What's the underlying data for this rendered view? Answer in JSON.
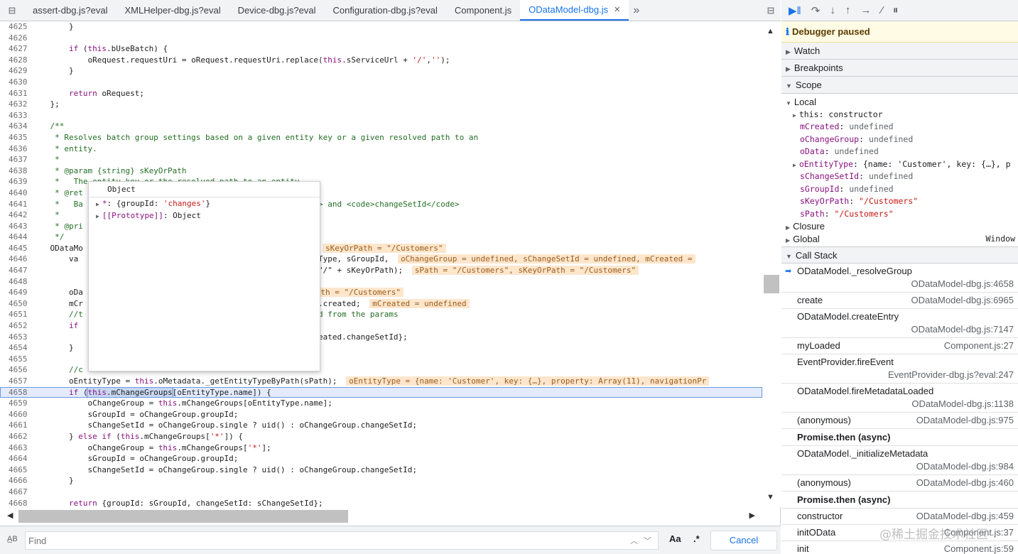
{
  "tabs": [
    {
      "label": "assert-dbg.js?eval"
    },
    {
      "label": "XMLHelper-dbg.js?eval"
    },
    {
      "label": "Device-dbg.js?eval"
    },
    {
      "label": "Configuration-dbg.js?eval"
    },
    {
      "label": "Component.js"
    },
    {
      "label": "ODataModel-dbg.js",
      "active": true
    }
  ],
  "code_lines": [
    {
      "n": "4625",
      "h": "        }"
    },
    {
      "n": "4626",
      "h": ""
    },
    {
      "n": "4627",
      "h": "        <span class=\"kw\">if</span> (<span class=\"kw\">this</span>.bUseBatch) {"
    },
    {
      "n": "4628",
      "h": "            oRequest.requestUri = oRequest.requestUri.replace(<span class=\"kw\">this</span>.sServiceUrl + <span class=\"str\">'/'</span>,<span class=\"str\">''</span>);"
    },
    {
      "n": "4629",
      "h": "        }"
    },
    {
      "n": "4630",
      "h": ""
    },
    {
      "n": "4631",
      "h": "        <span class=\"kw\">return</span> oRequest;"
    },
    {
      "n": "4632",
      "h": "    };"
    },
    {
      "n": "4633",
      "h": ""
    },
    {
      "n": "4634",
      "h": "    <span class=\"cm\">/**</span>"
    },
    {
      "n": "4635",
      "h": "<span class=\"cm\">     * Resolves batch group settings based on a given entity key or a given resolved path to an</span>"
    },
    {
      "n": "4636",
      "h": "<span class=\"cm\">     * entity.</span>"
    },
    {
      "n": "4637",
      "h": "<span class=\"cm\">     *</span>"
    },
    {
      "n": "4638",
      "h": "<span class=\"cm\">     * @param {string} sKeyOrPath</span>"
    },
    {
      "n": "4639",
      "h": "<span class=\"cm\">     *   The entity key or the resolved path to an entity</span>"
    },
    {
      "n": "4640",
      "h": "<span class=\"cm\">     * @ret</span>"
    },
    {
      "n": "4641",
      "h": "<span class=\"cm\">     *   Ba                                                  &gt; and &lt;code&gt;changeSetId&lt;/code&gt;</span>"
    },
    {
      "n": "4642",
      "h": "<span class=\"cm\">     *</span>"
    },
    {
      "n": "4643",
      "h": "<span class=\"cm\">     * @pri</span>"
    },
    {
      "n": "4644",
      "h": "<span class=\"cm\">     */</span>"
    },
    {
      "n": "4645",
      "h": "    ODataMo                                           Path) {<span class=\"iv\">sKeyOrPath = \"/Customers\"</span>"
    },
    {
      "n": "4646",
      "h": "        va                                            oEntityType, sGroupId, <span class=\"iv\">oChangeGroup = undefined, sChangeSetId = undefined, mCreated =</span>"
    },
    {
      "n": "4647",
      "h": "                                                      ath : (\"/\" + sKeyOrPath); <span class=\"iv\">sPath = \"/Customers\", sKeyOrPath = \"/Customers\"</span>"
    },
    {
      "n": "4648",
      "h": ""
    },
    {
      "n": "4649",
      "h": "        oDa                                         <span class=\"iv\">ned, sPath = \"/Customers\"</span>"
    },
    {
      "n": "4650",
      "h": "        mCr                                           etadata.created; <span class=\"iv\">mCreated = undefined</span>"
    },
    {
      "n": "4651",
      "h": "        <span class=\"cm\">//t                                           etrieved from the params</span>"
    },
    {
      "n": "4652",
      "h": "        <span class=\"kw\">if</span>"
    },
    {
      "n": "4653",
      "h": "                                                      Id: mCreated.changeSetId};"
    },
    {
      "n": "4654",
      "h": "        }"
    },
    {
      "n": "4655",
      "h": ""
    },
    {
      "n": "4656",
      "h": "        <span class=\"cm\">//c</span>"
    },
    {
      "n": "4657",
      "h": "        oEntityType = <span class=\"kw\">this</span>.oMetadata._getEntityTypeByPath(sPath); <span class=\"iv\">oEntityType = {name: 'Customer', key: {…}, property: Array(11), navigationPr</span>"
    },
    {
      "n": "4658",
      "exec": true,
      "h": "        <span class=\"kw\">if</span> (<span class=\"hl\"><span class=\"kw\">this</span>.mChangeGroups</span>[oEntityType.name]) {"
    },
    {
      "n": "4659",
      "h": "            oChangeGroup = <span class=\"kw\">this</span>.mChangeGroups[oEntityType.name];"
    },
    {
      "n": "4660",
      "h": "            sGroupId = oChangeGroup.groupId;"
    },
    {
      "n": "4661",
      "h": "            sChangeSetId = oChangeGroup.single ? uid() : oChangeGroup.changeSetId;"
    },
    {
      "n": "4662",
      "h": "        } <span class=\"kw\">else if</span> (<span class=\"kw\">this</span>.mChangeGroups[<span class=\"str\">'*'</span>]) {"
    },
    {
      "n": "4663",
      "h": "            oChangeGroup = <span class=\"kw\">this</span>.mChangeGroups[<span class=\"str\">'*'</span>];"
    },
    {
      "n": "4664",
      "h": "            sGroupId = oChangeGroup.groupId;"
    },
    {
      "n": "4665",
      "h": "            sChangeSetId = oChangeGroup.single ? uid() : oChangeGroup.changeSetId;"
    },
    {
      "n": "4666",
      "h": "        }"
    },
    {
      "n": "4667",
      "h": ""
    },
    {
      "n": "4668",
      "h": "        <span class=\"kw\">return</span> {groupId: sGroupId, changeSetId: sChangeSetId};"
    },
    {
      "n": "4669",
      "h": "    };"
    }
  ],
  "popover": {
    "title": "Object",
    "rows": [
      {
        "key": "*",
        "value_prefix": ": {groupId: ",
        "value_str": "'changes'",
        "value_suffix": "}"
      },
      {
        "key": "[[Prototype]]",
        "value_prefix": ": Object",
        "value_str": "",
        "value_suffix": ""
      }
    ]
  },
  "find": {
    "placeholder": "Find",
    "case_label": "Aa",
    "regex_label": ".*",
    "cancel_label": "Cancel"
  },
  "sidebar": {
    "paused_label": "Debugger paused",
    "sections": {
      "watch": "Watch",
      "breakpoints": "Breakpoints",
      "scope": "Scope",
      "call_stack": "Call Stack"
    },
    "scope": {
      "local_label": "Local",
      "local_vars": [
        {
          "expand": true,
          "key": "this",
          "plain": true,
          "value": "constructor",
          "type": "plain"
        },
        {
          "key": "mCreated",
          "value": "undefined",
          "type": "undef"
        },
        {
          "key": "oChangeGroup",
          "value": "undefined",
          "type": "undef"
        },
        {
          "key": "oData",
          "value": "undefined",
          "type": "undef"
        },
        {
          "expand": true,
          "key": "oEntityType",
          "value": "{name: 'Customer', key: {…}, p",
          "type": "obj"
        },
        {
          "key": "sChangeSetId",
          "value": "undefined",
          "type": "undef"
        },
        {
          "key": "sGroupId",
          "value": "undefined",
          "type": "undef"
        },
        {
          "key": "sKeyOrPath",
          "value": "\"/Customers\"",
          "type": "str"
        },
        {
          "key": "sPath",
          "value": "\"/Customers\"",
          "type": "str"
        }
      ],
      "closure_label": "Closure",
      "global_label": "Global",
      "global_value": "Window"
    },
    "call_stack": [
      {
        "fn": "ODataModel._resolveGroup",
        "loc": "ODataModel-dbg.js:4658",
        "active": true
      },
      {
        "fn": "create",
        "loc": "ODataModel-dbg.js:6965",
        "one": true
      },
      {
        "fn": "ODataModel.createEntry",
        "loc": "ODataModel-dbg.js:7147"
      },
      {
        "fn": "myLoaded",
        "loc": "Component.js:27",
        "one": true
      },
      {
        "fn": "EventProvider.fireEvent",
        "loc": "EventProvider-dbg.js?eval:247"
      },
      {
        "fn": "ODataModel.fireMetadataLoaded",
        "loc": "ODataModel-dbg.js:1138"
      },
      {
        "fn": "(anonymous)",
        "loc": "ODataModel-dbg.js:975",
        "one": true
      },
      {
        "async": "Promise.then (async)"
      },
      {
        "fn": "ODataModel._initializeMetadata",
        "loc": "ODataModel-dbg.js:984"
      },
      {
        "fn": "(anonymous)",
        "loc": "ODataModel-dbg.js:460",
        "one": true
      },
      {
        "async": "Promise.then (async)"
      },
      {
        "fn": "constructor",
        "loc": "ODataModel-dbg.js:459",
        "one": true
      },
      {
        "fn": "initOData",
        "loc": "Component.js:37",
        "one": true
      },
      {
        "fn": "init",
        "loc": "Component.js:59",
        "one": true
      }
    ]
  },
  "watermark": "@稀土掘金技术社区",
  "icons": [
    "toggle-navigator-icon",
    "tab-close-icon",
    "more-tabs-icon",
    "toggle-debugger-icon",
    "resume-icon",
    "step-over-icon",
    "step-into-icon",
    "step-out-icon",
    "step-icon",
    "deactivate-breakpoints-icon",
    "pause-exceptions-icon",
    "scroll-up-icon",
    "scroll-down-icon",
    "scroll-left-icon",
    "scroll-right-icon",
    "search-icon",
    "find-prev-icon",
    "find-next-icon",
    "current-frame-icon"
  ]
}
